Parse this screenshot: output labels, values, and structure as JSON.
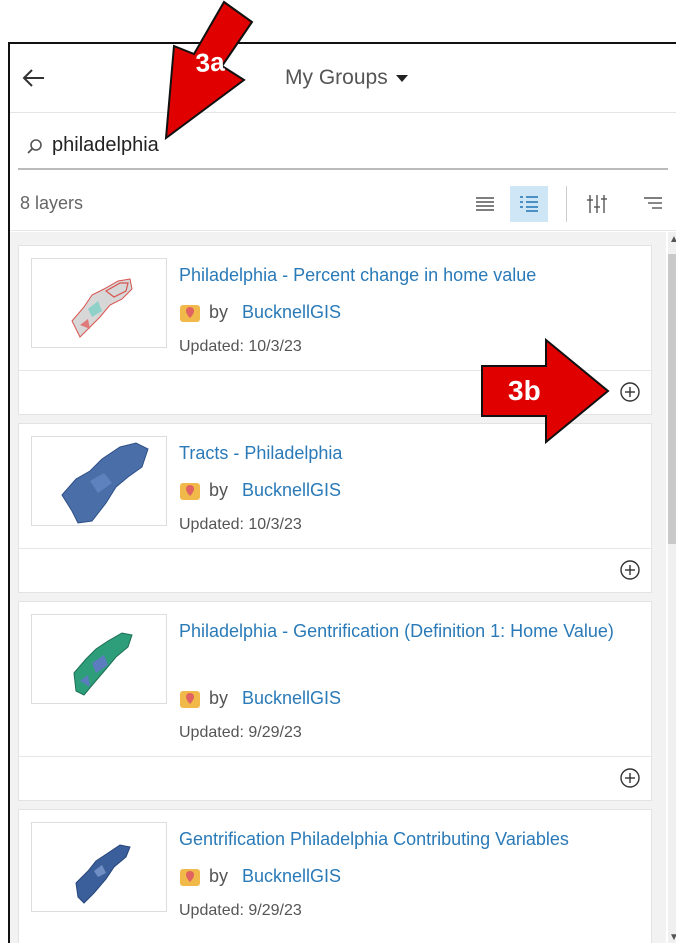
{
  "header": {
    "title": "My Groups"
  },
  "search": {
    "value": "philadelphia"
  },
  "toolbar": {
    "count": "8 layers"
  },
  "annotations": {
    "a": "3a",
    "b": "3b"
  },
  "items": [
    {
      "title": "Philadelphia - Percent change in home value",
      "by": "by",
      "owner": "BucknellGIS",
      "updated": "Updated: 10/3/23"
    },
    {
      "title": "Tracts - Philadelphia",
      "by": "by",
      "owner": "BucknellGIS",
      "updated": "Updated: 10/3/23"
    },
    {
      "title": "Philadelphia - Gentrification (Definition 1: Home Value)",
      "by": "by",
      "owner": "BucknellGIS",
      "updated": "Updated: 9/29/23"
    },
    {
      "title": "Gentrification Philadelphia Contributing Variables",
      "by": "by",
      "owner": "BucknellGIS",
      "updated": "Updated: 9/29/23"
    }
  ],
  "colors": {
    "link": "#2a7ab8",
    "callout": "#e00000",
    "active_button": "#cfe6f7"
  }
}
